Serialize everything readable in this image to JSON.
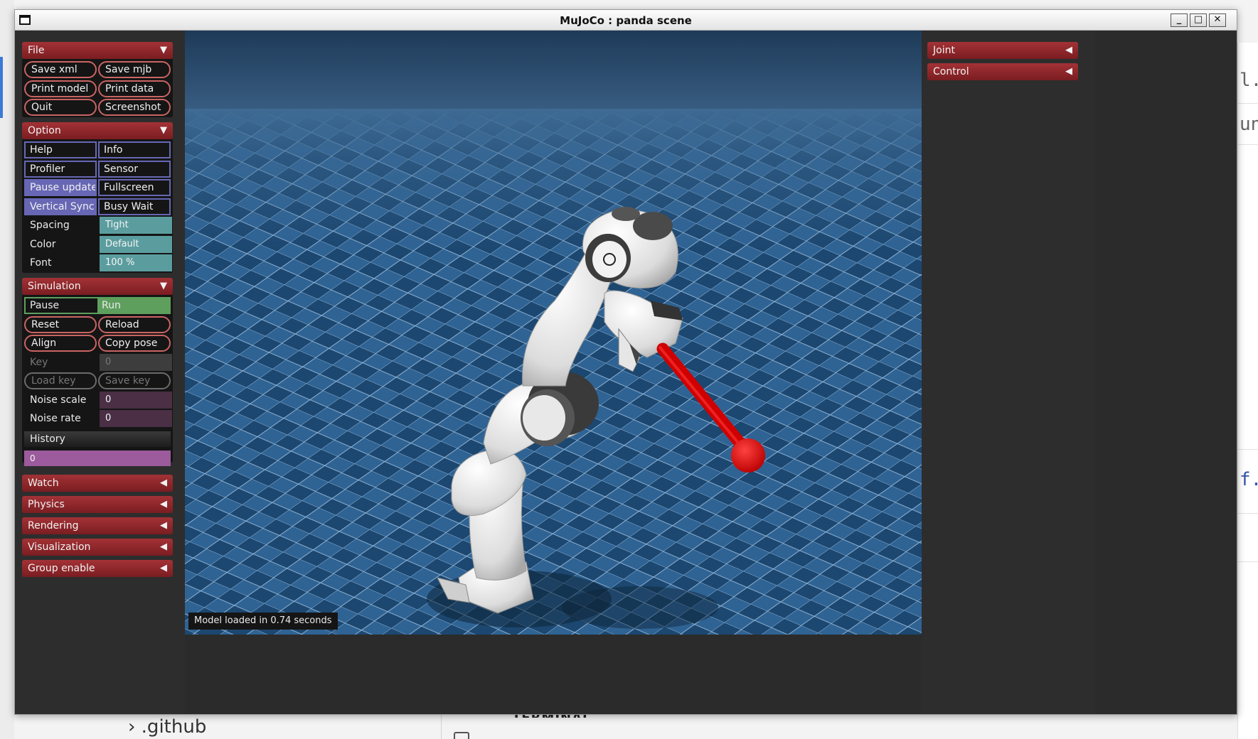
{
  "window": {
    "title": "MuJoCo : panda scene"
  },
  "background": {
    "left_text_1": "l.py",
    "left_text_2": "un_",
    "left_text_3": "f.",
    "bottom_folder": ".github",
    "bottom_panel": "TERMINAL"
  },
  "file": {
    "header": "File",
    "buttons": [
      "Save xml",
      "Save mjb",
      "Print model",
      "Print data",
      "Quit",
      "Screenshot"
    ]
  },
  "option": {
    "header": "Option",
    "toggles": [
      {
        "label": "Help",
        "on": false
      },
      {
        "label": "Info",
        "on": false
      },
      {
        "label": "Profiler",
        "on": false
      },
      {
        "label": "Sensor",
        "on": false
      },
      {
        "label": "Pause update",
        "on": true
      },
      {
        "label": "Fullscreen",
        "on": false
      },
      {
        "label": "Vertical Sync",
        "on": true
      },
      {
        "label": "Busy Wait",
        "on": false
      }
    ],
    "spacing_label": "Spacing",
    "spacing_value": "Tight",
    "color_label": "Color",
    "color_value": "Default",
    "font_label": "Font",
    "font_value": "100 %"
  },
  "simulation": {
    "header": "Simulation",
    "pause": "Pause",
    "run": "Run",
    "reset": "Reset",
    "reload": "Reload",
    "align": "Align",
    "copy_pose": "Copy pose",
    "key_label": "Key",
    "key_value": "0",
    "load_key": "Load key",
    "save_key": "Save key",
    "noise_scale_label": "Noise scale",
    "noise_scale_value": "0",
    "noise_rate_label": "Noise rate",
    "noise_rate_value": "0",
    "history_label": "History",
    "history_value": "0"
  },
  "collapsed_sections": [
    "Watch",
    "Physics",
    "Rendering",
    "Visualization",
    "Group enable"
  ],
  "right_sections": [
    "Joint",
    "Control"
  ],
  "status": "Model loaded in 0.74 seconds",
  "icons": {
    "expanded": "▼",
    "collapsed": "◀",
    "minimize": "_",
    "maximize": "□",
    "close": "✕"
  }
}
